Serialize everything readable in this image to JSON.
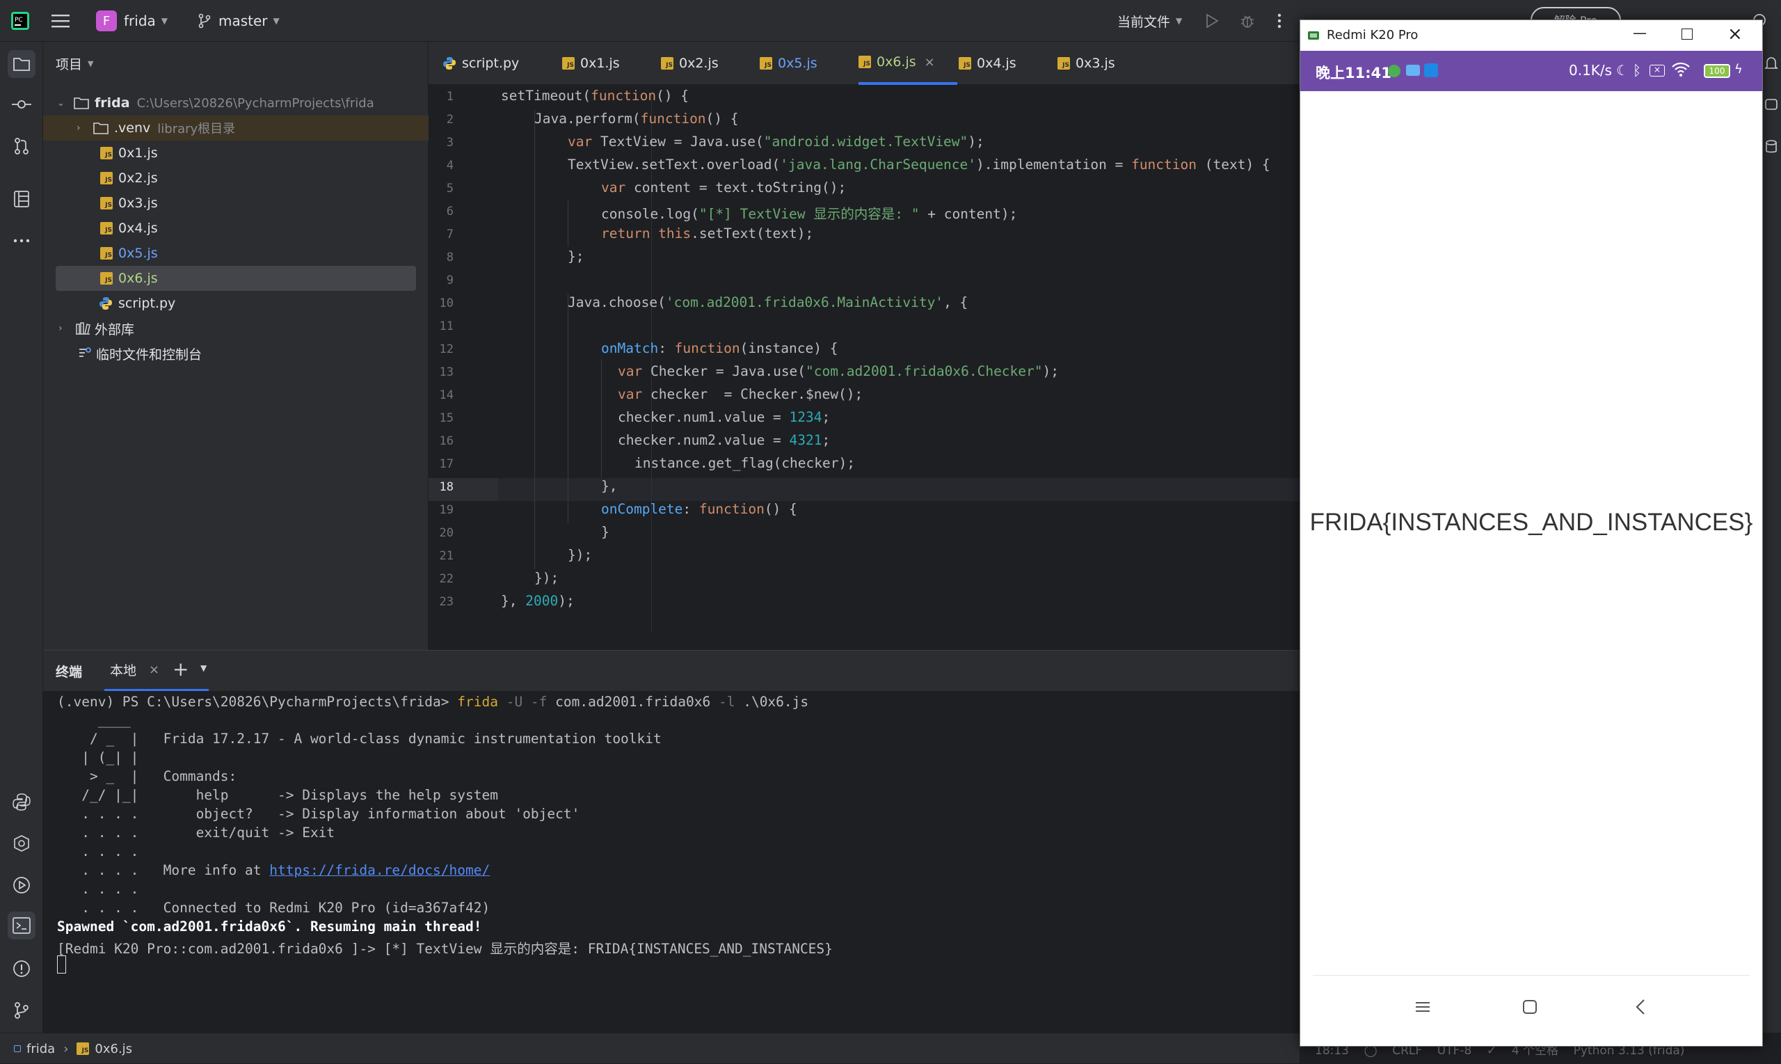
{
  "titlebar": {
    "project_badge": "F",
    "project_name": "frida",
    "branch": "master",
    "run_config": "当前文件"
  },
  "project_panel": {
    "title": "项目",
    "root_name": "frida",
    "root_path": "C:\\Users\\20826\\PycharmProjects\\frida",
    "venv_name": ".venv",
    "venv_tag": "library根目录",
    "files": [
      "0x1.js",
      "0x2.js",
      "0x3.js",
      "0x4.js",
      "0x5.js",
      "0x6.js",
      "script.py"
    ],
    "external_libs": "外部库",
    "scratches": "临时文件和控制台"
  },
  "tabs": [
    "script.py",
    "0x1.js",
    "0x2.js",
    "0x5.js",
    "0x6.js",
    "0x4.js",
    "0x3.js"
  ],
  "editor": {
    "line_numbers": [
      "1",
      "2",
      "3",
      "4",
      "5",
      "6",
      "7",
      "8",
      "9",
      "10",
      "11",
      "12",
      "13",
      "14",
      "15",
      "16",
      "17",
      "18",
      "19",
      "20",
      "21",
      "22",
      "23"
    ],
    "l1": {
      "a": "setTimeout(",
      "b": "function",
      "c": "() {"
    },
    "l2": {
      "a": "Java.perform(",
      "b": "function",
      "c": "() {"
    },
    "l3": {
      "a": "var",
      "b": " TextView = Java.use(",
      "c": "\"android.widget.TextView\"",
      "d": ");"
    },
    "l4": {
      "a": "TextView.setText.overload(",
      "b": "'java.lang.CharSequence'",
      "c": ").implementation = ",
      "d": "function",
      "e": " (text) {"
    },
    "l5": {
      "a": "var",
      "b": " content = text.toString();"
    },
    "l6": {
      "a": "console.log(",
      "b": "\"[*] TextView 显示的内容是: \"",
      "c": " + content);"
    },
    "l7": {
      "a": "return",
      "b": " this",
      "c": ".setText(text);"
    },
    "l8": "};",
    "l10": {
      "a": "Java.choose(",
      "b": "'com.ad2001.frida0x6.MainActivity'",
      "c": ", {"
    },
    "l12": {
      "a": "onMatch",
      "b": ": ",
      "c": "function",
      "d": "(instance) {"
    },
    "l13": {
      "a": "var",
      "b": " Checker = Java.use(",
      "c": "\"com.ad2001.frida0x6.Checker\"",
      "d": ");"
    },
    "l14": {
      "a": "var",
      "b": " checker  = Checker.$new();"
    },
    "l15": {
      "a": "checker.num1.value = ",
      "b": "1234",
      "c": ";"
    },
    "l16": {
      "a": "checker.num2.value = ",
      "b": "4321",
      "c": ";"
    },
    "l17": "instance.get_flag(checker);",
    "l18": "},",
    "l19": {
      "a": "onComplete",
      "b": ": ",
      "c": "function",
      "d": "() {"
    },
    "l20": "}",
    "l21": "});",
    "l22": "});",
    "l23": {
      "a": "}, ",
      "b": "2000",
      "c": ");"
    }
  },
  "terminal": {
    "title": "终端",
    "tab": "本地",
    "prompt": "(.venv) PS C:\\Users\\20826\\PycharmProjects\\frida> ",
    "cmd": "frida",
    "cmd_u": " -U -f",
    "cmd_pkg": " com.ad2001.frida0x6",
    "cmd_l": " -l",
    "cmd_file": " .\\0x6.js",
    "lines": [
      "     ____",
      "    / _  |   Frida 17.2.17 - A world-class dynamic instrumentation toolkit",
      "   | (_| |",
      "    > _  |   Commands:",
      "   /_/ |_|       help      -> Displays the help system",
      "   . . . .       object?   -> Display information about 'object'",
      "   . . . .       exit/quit -> Exit",
      "   . . . .",
      "   . . . .   More info at ",
      "   . . . .",
      "   . . . .   Connected to Redmi K20 Pro (id=a367af42)"
    ],
    "more_info_url": "https://frida.re/docs/home/",
    "spawned": "Spawned `com.ad2001.frida0x6`. Resuming main thread!",
    "result": "[Redmi K20 Pro::com.ad2001.frida0x6 ]-> [*] TextView 显示的内容是: FRIDA{INSTANCES_AND_INSTANCES}"
  },
  "statusbar": {
    "crumb1": "frida",
    "crumb2": "0x6.js",
    "right": "18:13    ◯    CRLF    UTF-8    ✓    4 个空格    Python 3.13 (frida)"
  },
  "phone": {
    "window_title": "Redmi K20 Pro",
    "time": "晚上11:41",
    "net_speed": "0.1K/s",
    "battery": "100",
    "flag": "FRIDA{INSTANCES_AND_INSTANCES}"
  },
  "partial_button": "解除 Pro"
}
